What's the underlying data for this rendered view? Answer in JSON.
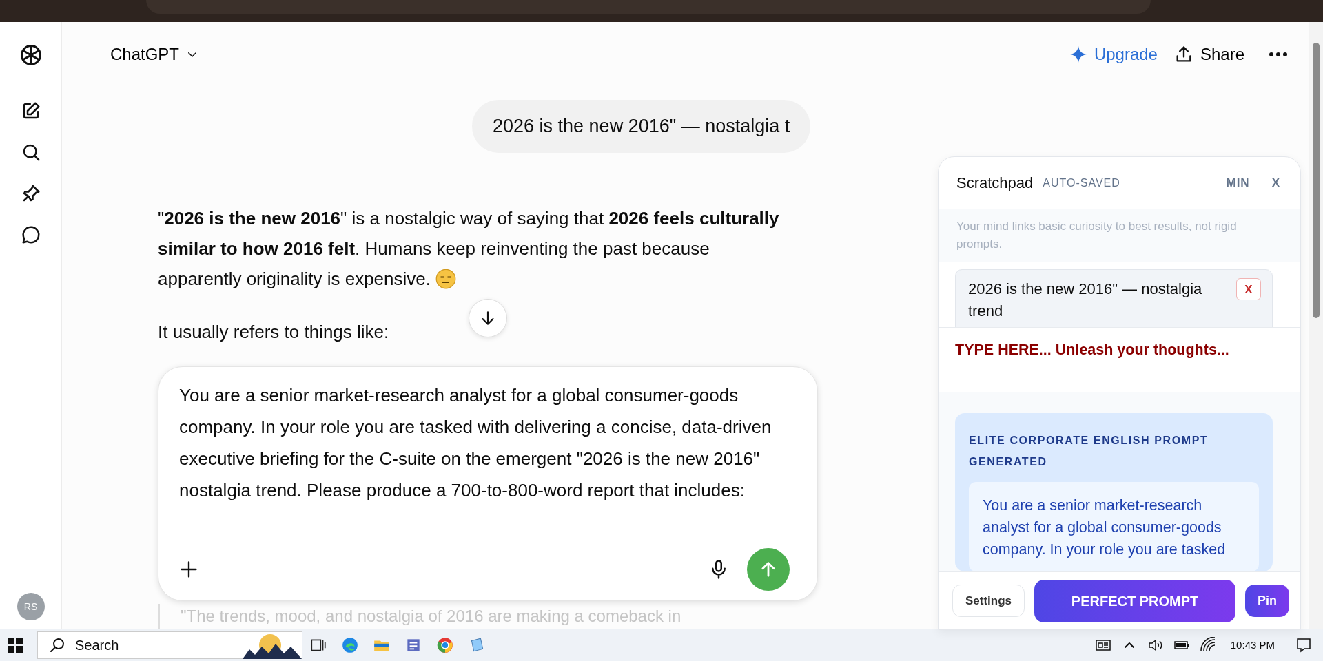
{
  "sidebar": {
    "avatar": "RS"
  },
  "header": {
    "title": "ChatGPT",
    "actions": [
      {
        "kind": "upgrade",
        "label": "Upgrade"
      },
      {
        "kind": "share",
        "label": "Share"
      }
    ]
  },
  "chat": {
    "user_message": "2026 is the new 2016\" — nostalgia t",
    "answer": [
      "\"**2026 is the new 2016**\" is a nostalgic way of saying that **2026 feels culturally similar to how 2016 felt**. Humans keep reinventing the past because apparently originality is expensive.",
      "It usually refers to things like:"
    ],
    "composer": {
      "value": "You are a senior market-research analyst for a global consumer-goods company. In your role you are tasked with delivering a concise, data-driven executive briefing for the C-suite on the emergent \"2026 is the new 2016\" nostalgia trend. Please produce a 700-to-800-word report that includes:"
    },
    "quote": "\"The trends, mood, and nostalgia of 2016 are making a comeback in"
  },
  "scratchpad": {
    "title": "Scratchpad",
    "status": "AUTO-SAVED",
    "minimize": "MIN",
    "close": "X",
    "hint": "Your mind links basic curiosity to best results, not rigid prompts.",
    "notes": [
      {
        "text": "2026 is the new 2016\" — nostalgia trend",
        "remove": "X"
      }
    ],
    "input": {
      "placeholder": "TYPE HERE... Unleash your thoughts..."
    },
    "result": {
      "heading": "ELITE CORPORATE ENGLISH PROMPT GENERATED",
      "text": "You are a senior market-research analyst for a global consumer-goods company. In your role you are tasked"
    },
    "buttons": [
      {
        "kind": "secondary",
        "label": "Settings"
      },
      {
        "kind": "primary",
        "label": "PERFECT PROMPT"
      },
      {
        "kind": "pin",
        "label": "Pin"
      }
    ]
  },
  "taskbar": {
    "search": "Search",
    "time": "10:43 PM"
  }
}
